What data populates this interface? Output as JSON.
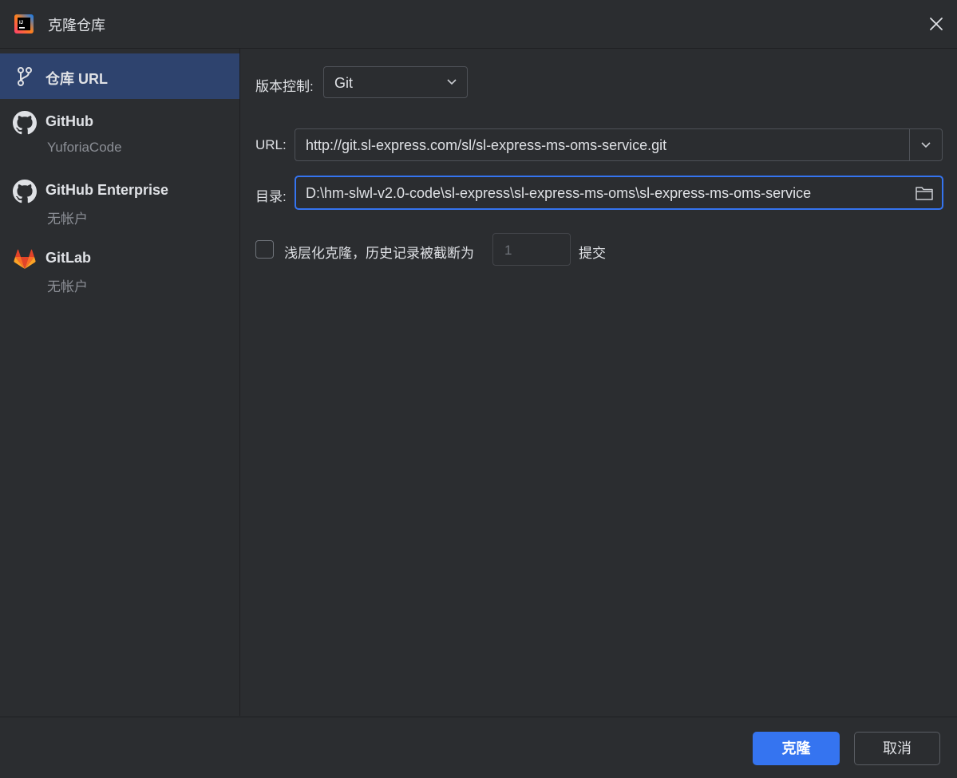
{
  "window": {
    "title": "克隆仓库",
    "close_icon": "close-icon",
    "app_icon": "intellij-idea-icon"
  },
  "sidebar": {
    "items": [
      {
        "icon": "vcs-branch-icon",
        "label": "仓库 URL",
        "selected": true
      },
      {
        "icon": "github-icon",
        "label": "GitHub",
        "sub": "YuforiaCode"
      },
      {
        "icon": "github-icon",
        "label": "GitHub Enterprise",
        "sub": "无帐户"
      },
      {
        "icon": "gitlab-icon",
        "label": "GitLab",
        "sub": "无帐户"
      }
    ]
  },
  "form": {
    "vcs_label": "版本控制:",
    "vcs_value": "Git",
    "url_label": "URL:",
    "url_value": "http://git.sl-express.com/sl/sl-express-ms-oms-service.git",
    "dir_label": "目录:",
    "dir_value": "D:\\hm-slwl-v2.0-code\\sl-express\\sl-express-ms-oms\\sl-express-ms-oms-service",
    "shallow_label": "浅层化克隆，历史记录被截断为",
    "shallow_checked": false,
    "shallow_depth": "1",
    "shallow_suffix": "提交"
  },
  "buttons": {
    "clone": "克隆",
    "cancel": "取消"
  },
  "colors": {
    "accent": "#3574f0",
    "background": "#2b2d30",
    "selected": "#2e436e"
  }
}
